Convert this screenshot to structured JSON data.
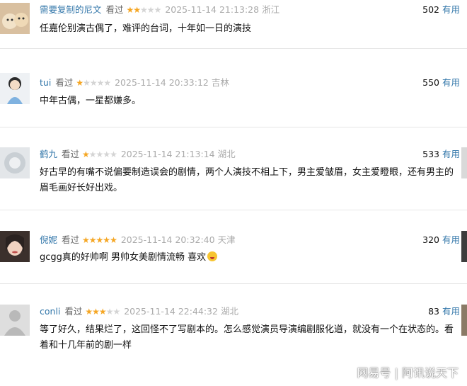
{
  "comments": [
    {
      "user": "需要复制的尼文",
      "watched": "看过",
      "rating": 2,
      "time": "2025-11-14 21:13:28",
      "location": "浙江",
      "votes": "502",
      "useful": "有用",
      "text": "任嘉伦别演古偶了，难评的台词，十年如一日的演技"
    },
    {
      "user": "tui",
      "watched": "看过",
      "rating": 1,
      "time": "2025-11-14 20:33:12",
      "location": "吉林",
      "votes": "550",
      "useful": "有用",
      "text": "中年古偶，一星都嫌多。"
    },
    {
      "user": "鹤九",
      "watched": "看过",
      "rating": 1,
      "time": "2025-11-14 21:13:14",
      "location": "湖北",
      "votes": "533",
      "useful": "有用",
      "text": "好古早的有嘴不说偏要制造误会的剧情，两个人演技不相上下，男主爱皱眉，女主爱瞪眼，还有男主的眉毛画好长好出戏。"
    },
    {
      "user": "倪妮",
      "watched": "看过",
      "rating": 5,
      "time": "2025-11-14 20:32:40",
      "location": "天津",
      "votes": "320",
      "useful": "有用",
      "text": "gcgg真的好帅啊 男帅女美剧情流畅 喜欢"
    },
    {
      "user": "conli",
      "watched": "看过",
      "rating": 3,
      "time": "2025-11-14 22:44:32",
      "location": "湖北",
      "votes": "83",
      "useful": "有用",
      "text": "等了好久，结果烂了，这回怪不了写剧本的。怎么感觉演员导演编剧服化道，就没有一个在状态的。看着和十几年前的剧一样"
    }
  ],
  "watermark": "网易号 | 阿讯说天下"
}
